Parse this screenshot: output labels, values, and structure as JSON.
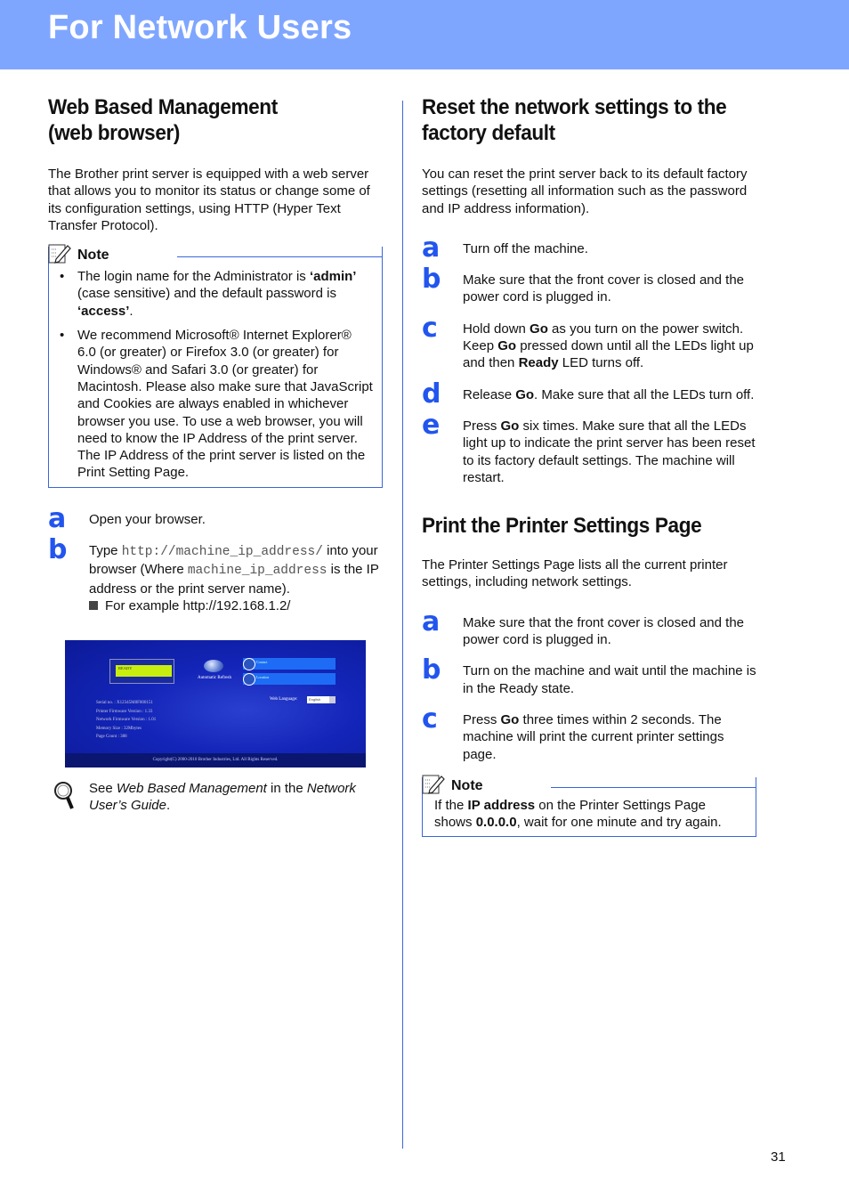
{
  "header": {
    "title": "For Network Users",
    "color": "#7fa6ff"
  },
  "left": {
    "heading": "Web Based Management (web browser)",
    "intro": "The Brother print server is equipped with a web server that allows you to monitor its status or change some of its configuration settings, using HTTP (Hyper Text Transfer Protocol).",
    "note": {
      "title": "Note",
      "bullets": [
        {
          "pre": "The login name for the Administrator is ",
          "b1": "‘admin’",
          "mid": " (case sensitive) and the default password is ",
          "b2": "‘access’",
          "post": "."
        },
        {
          "text": "We recommend Microsoft® Internet Explorer® 6.0 (or greater) or Firefox 3.0 (or greater) for Windows® and Safari 3.0 (or greater) for Macintosh. Please also make sure that JavaScript and Cookies are always enabled in whichever browser you use. To use a web browser, you will need to know the IP Address of the print server. The IP Address of the print server is listed on the Print Setting Page."
        }
      ]
    },
    "steps": [
      {
        "letter": "a",
        "text": "Open your browser."
      },
      {
        "letter": "b",
        "pre": "Type ",
        "code1": "http://machine_ip_address/",
        "mid": " into your browser (Where ",
        "code2": "machine_ip_address",
        "post": " is the IP address or the print server name).",
        "example": "For example http://192.168.1.2/"
      }
    ],
    "screenshot": {
      "lcd": "READY",
      "refresh_label": "Automatic Refresh",
      "contact": "Contact",
      "location": "Location",
      "info": [
        "Serial no. : X12345M8F000151",
        "Printer Firmware Version : 1.33",
        "Network Firmware Version : 1.01",
        "Memory Size : 32Mbytes",
        "Page Count : 388"
      ],
      "web_language_label": "Web Language:",
      "web_language_value": "English",
      "copyright": "Copyright(C) 2000-2010 Brother Industries, Ltd. All Rights Reserved."
    },
    "see_also": {
      "pre": "See ",
      "i1": "Web Based Management",
      "mid": " in the ",
      "i2": "Network User’s Guide",
      "post": "."
    }
  },
  "right": {
    "reset": {
      "heading": "Reset the network settings to the factory default",
      "intro": "You can reset the print server back to its default factory settings (resetting all information such as the password and IP address information).",
      "steps": [
        {
          "letter": "a",
          "html_parts": [
            "Turn off the machine."
          ]
        },
        {
          "letter": "b",
          "html_parts": [
            "Make sure that the front cover is closed and the power cord is plugged in."
          ]
        },
        {
          "letter": "c",
          "p1": "Hold down ",
          "b1": "Go",
          "p2": " as you turn on the power switch. Keep ",
          "b2": "Go",
          "p3": " pressed down until all the LEDs light up and then ",
          "b3": "Ready",
          "p4": " LED turns off."
        },
        {
          "letter": "d",
          "p1": "Release ",
          "b1": "Go",
          "p2": ". Make sure that all the LEDs turn off."
        },
        {
          "letter": "e",
          "p1": "Press ",
          "b1": "Go",
          "p2": " six times. Make sure that all the LEDs light up to indicate the print server has been reset to its factory default settings. The machine will restart."
        }
      ]
    },
    "print": {
      "heading": "Print the Printer Settings Page",
      "intro": "The Printer Settings Page lists all the current printer settings, including network settings.",
      "steps": [
        {
          "letter": "a",
          "text": "Make sure that the front cover is closed and the power cord is plugged in."
        },
        {
          "letter": "b",
          "text": "Turn on the machine and wait until the machine is in the Ready state."
        },
        {
          "letter": "c",
          "p1": "Press ",
          "b1": "Go",
          "p2": " three times within 2 seconds. The machine will print the current printer settings page."
        }
      ],
      "note": {
        "title": "Note",
        "p1": "If the ",
        "b1": "IP address",
        "p2": " on the Printer Settings Page shows ",
        "b2": "0.0.0.0",
        "p3": ", wait for one minute and try again."
      }
    }
  },
  "page_number": "31"
}
